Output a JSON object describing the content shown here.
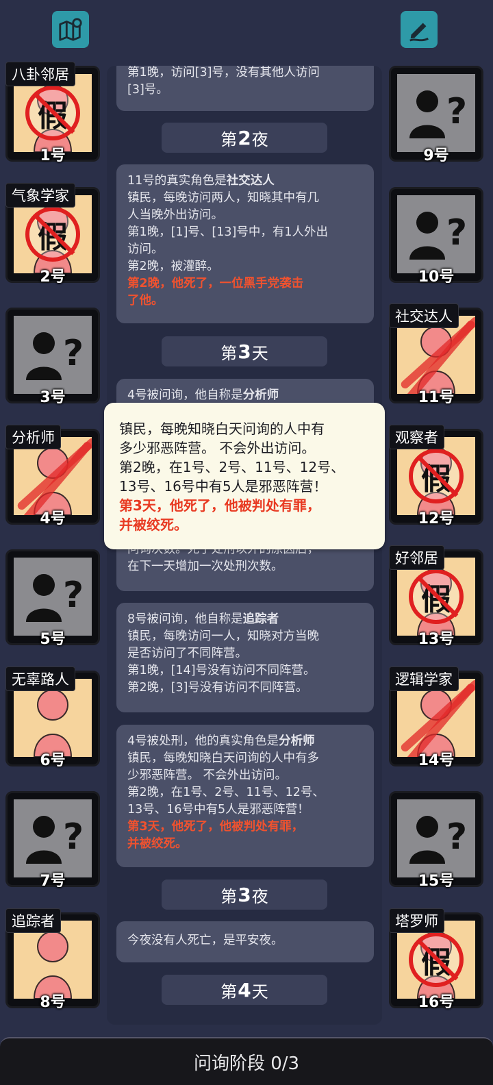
{
  "header": {
    "left_icon": "map-icon",
    "right_icon": "notes-pen-icon"
  },
  "players_left": [
    {
      "num": "1号",
      "role": "八卦邻居",
      "fake": true
    },
    {
      "num": "2号",
      "role": "气象学家",
      "fake": true
    },
    {
      "num": "3号",
      "role": "",
      "unknown": true
    },
    {
      "num": "4号",
      "role": "分析师",
      "dead": true
    },
    {
      "num": "5号",
      "role": "",
      "unknown": true
    },
    {
      "num": "6号",
      "role": "无辜路人"
    },
    {
      "num": "7号",
      "role": "",
      "unknown": true
    },
    {
      "num": "8号",
      "role": "追踪者"
    }
  ],
  "players_right": [
    {
      "num": "9号",
      "role": "",
      "unknown": true
    },
    {
      "num": "10号",
      "role": "",
      "unknown": true
    },
    {
      "num": "11号",
      "role": "社交达人",
      "dead": true
    },
    {
      "num": "12号",
      "role": "观察者",
      "fake": true
    },
    {
      "num": "13号",
      "role": "好邻居",
      "fake": true
    },
    {
      "num": "14号",
      "role": "逻辑学家",
      "dead": true
    },
    {
      "num": "15号",
      "role": "",
      "unknown": true
    },
    {
      "num": "16号",
      "role": "塔罗师",
      "fake": true
    }
  ],
  "fake_stamp_text": "假",
  "log": {
    "m1_l1": "第1晚，访问[3]号，没有其他人访问",
    "m1_l2": "[3]号。",
    "phase_night2": {
      "pre": "第",
      "n": "2",
      "post": "夜"
    },
    "m2_l1_pre": "11号的真实角色是",
    "m2_l1_role": "社交达人",
    "m2_l2": "镇民，每晚访问两人，知晓其中有几",
    "m2_l3": "人当晚外出访问。",
    "m2_l4": "第1晚，[1]号、[13]号中，有1人外出",
    "m2_l5": "访问。",
    "m2_l6": "第2晚，被灌醉。",
    "m2_red1": "第2晚，他死了，一位黑手党袭击",
    "m2_red2": "了他。",
    "phase_day3": {
      "pre": "第",
      "n": "3",
      "post": "天"
    },
    "m3_l1_pre": "4号被问询，他自称是",
    "m3_l1_role": "分析师",
    "m4_l1": "问询次数。死于处刑以外的原因后，",
    "m4_l2": "在下一天增加一次处刑次数。",
    "m5_l1_pre": "8号被问询，他自称是",
    "m5_l1_role": "追踪者",
    "m5_l2": "镇民，每晚访问一人，知晓对方当晚",
    "m5_l3": "是否访问了不同阵营。",
    "m5_l4": "第1晚，[14]号没有访问不同阵营。",
    "m5_l5": "第2晚，[3]号没有访问不同阵营。",
    "m6_l1_pre": "4号被处刑，他的真实角色是",
    "m6_l1_role": "分析师",
    "m6_l2": "镇民，每晚知晓白天问询的人中有多",
    "m6_l3": "少邪恶阵营。 不会外出访问。",
    "m6_l4": "第2晚，在1号、2号、11号、12号、",
    "m6_l5": "13号、16号中有5人是邪恶阵营！",
    "m6_red1": "第3天，他死了，他被判处有罪，",
    "m6_red2": "并被绞死。",
    "phase_night3": {
      "pre": "第",
      "n": "3",
      "post": "夜"
    },
    "m7_l1": "今夜没有人死亡，是平安夜。",
    "phase_day4": {
      "pre": "第",
      "n": "4",
      "post": "天"
    }
  },
  "tooltip": {
    "l1": "镇民，每晚知晓白天问询的人中有",
    "l2": "多少邪恶阵营。 不会外出访问。",
    "l3": "第2晚，在1号、2号、11号、12号、",
    "l4": "13号、16号中有5人是邪恶阵营！",
    "red1": "第3天，他死了，他被判处有罪，",
    "red2": "并被绞死。"
  },
  "bottom": {
    "label": "问询阶段 0/3"
  },
  "colors": {
    "background": "#2a2f48",
    "accent_teal": "#2e9aa8",
    "alert_red": "#f0522f",
    "card_face": "#f6d49d"
  }
}
